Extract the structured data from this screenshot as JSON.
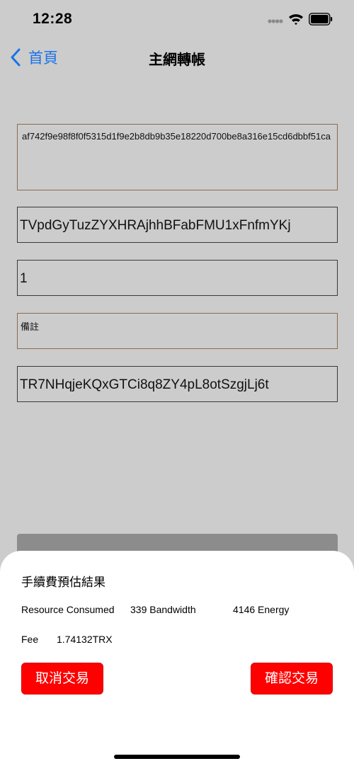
{
  "status_bar": {
    "time": "12:28"
  },
  "nav": {
    "back_label": "首頁",
    "title": "主網轉帳"
  },
  "form": {
    "txid": "af742f9e98f8f0f5315d1f9e2b8db9b35e18220d700be8a316e15cd6dbbf51ca",
    "from_address": "TVpdGyTuzZYXHRAjhhBFabFMU1xFnfmYKj",
    "amount": "1",
    "memo_placeholder": "備註",
    "to_address": "TR7NHqjeKQxGTCi8q8ZY4pL8otSzgjLj6t"
  },
  "sheet": {
    "title": "手續費預估結果",
    "resource_label": "Resource Consumed",
    "bandwidth": "339 Bandwidth",
    "energy": "4146 Energy",
    "fee_label": "Fee",
    "fee_value": "1.74132TRX",
    "cancel_label": "取消交易",
    "confirm_label": "確認交易"
  },
  "colors": {
    "background": "#cccccc",
    "accent": "#1a73e8",
    "button": "#ff0000"
  }
}
